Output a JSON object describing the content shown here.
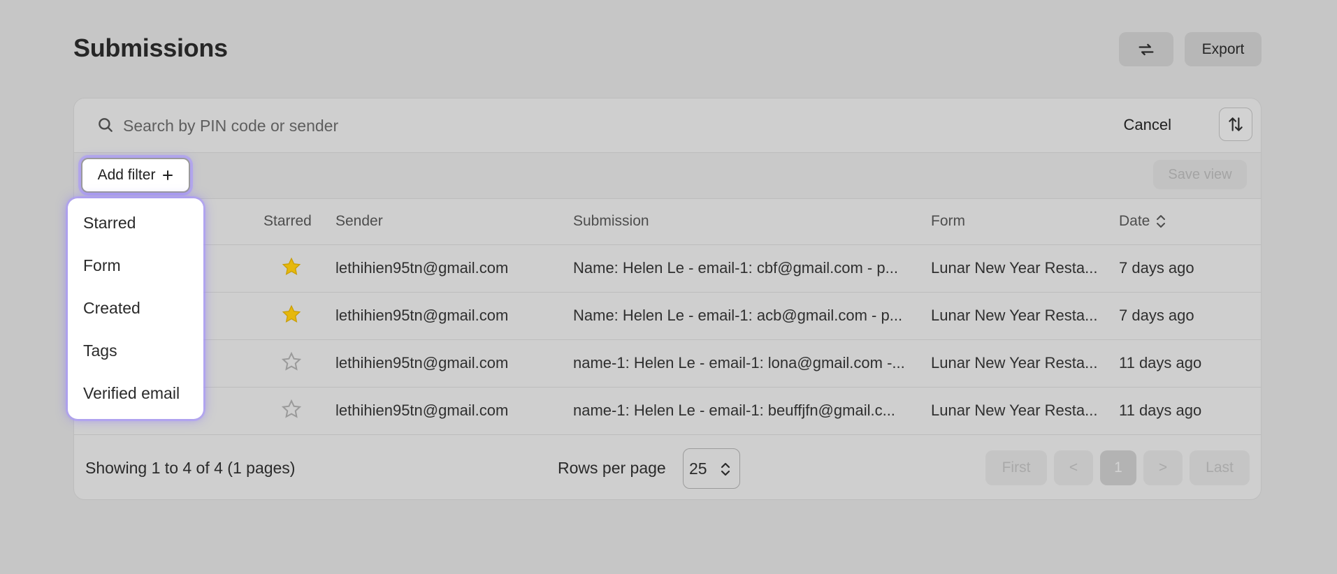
{
  "header": {
    "title": "Submissions",
    "export_label": "Export",
    "refresh_icon": "refresh-icon"
  },
  "search": {
    "placeholder": "Search by PIN code or sender",
    "cancel_label": "Cancel",
    "sort_icon": "sort-arrows-icon"
  },
  "filters": {
    "add_filter_label": "Add filter",
    "add_icon": "plus-icon",
    "save_view_label": "Save view",
    "menu": [
      "Starred",
      "Form",
      "Created",
      "Tags",
      "Verified email"
    ]
  },
  "table": {
    "columns": {
      "starred": "Starred",
      "sender": "Sender",
      "submission": "Submission",
      "form": "Form",
      "date": "Date"
    },
    "rows": [
      {
        "starred": true,
        "sender": "lethihien95tn@gmail.com",
        "submission": "Name: Helen Le - email-1: cbf@gmail.com - p...",
        "form": "Lunar New Year Resta...",
        "date": "7 days ago"
      },
      {
        "starred": true,
        "sender": "lethihien95tn@gmail.com",
        "submission": "Name: Helen Le - email-1: acb@gmail.com - p...",
        "form": "Lunar New Year Resta...",
        "date": "7 days ago"
      },
      {
        "starred": false,
        "sender": "lethihien95tn@gmail.com",
        "submission": "name-1: Helen Le - email-1: lona@gmail.com -...",
        "form": "Lunar New Year Resta...",
        "date": "11 days ago"
      },
      {
        "starred": false,
        "sender": "lethihien95tn@gmail.com",
        "submission": "name-1: Helen Le - email-1: beuffjfn@gmail.c...",
        "form": "Lunar New Year Resta...",
        "date": "11 days ago"
      }
    ]
  },
  "footer": {
    "showing": "Showing 1 to 4 of 4 (1 pages)",
    "rows_per_page_label": "Rows per page",
    "rows_per_page_value": "25",
    "pager": {
      "first": "First",
      "prev": "<",
      "page": "1",
      "next": ">",
      "last": "Last"
    }
  },
  "colors": {
    "star_filled": "#e6b80c",
    "focus_glow": "#8f78ff",
    "backdrop": "#c6c6c6"
  }
}
